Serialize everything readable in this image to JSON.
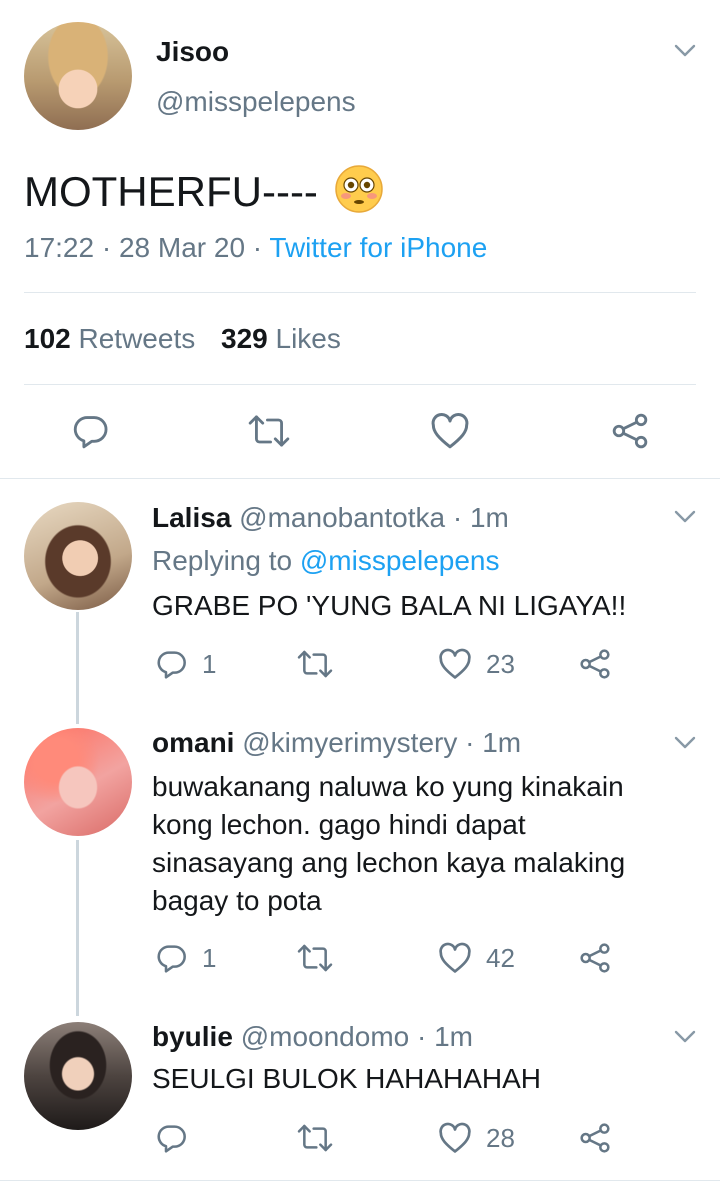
{
  "main_tweet": {
    "name": "Jisoo",
    "handle": "@misspelepens",
    "text": "MOTHERFU----",
    "emoji_icon": "flushed-face-emoji",
    "time": "17:22 · 28 Mar 20 ·",
    "source": "Twitter for iPhone",
    "retweets_count": "102",
    "retweets_label": "Retweets",
    "likes_count": "329",
    "likes_label": "Likes"
  },
  "replies": [
    {
      "name": "Lalisa",
      "handle": "@manobantotka · 1m",
      "replying_prefix": "Replying to",
      "replying_handle": "@misspelepens",
      "text": "GRABE PO 'YUNG BALA NI LIGAYA!!",
      "reply_count": "1",
      "retweet_count": "",
      "like_count": "23"
    },
    {
      "name": "omani",
      "handle": "@kimyerimystery · 1m",
      "text_lines": [
        "buwakanang naluwa ko yung kinakain",
        "kong lechon. gago hindi dapat",
        "sinasayang ang lechon kaya malaking",
        "bagay to pota"
      ],
      "reply_count": "1",
      "retweet_count": "",
      "like_count": "42"
    },
    {
      "name": "byulie",
      "handle": "@moondomo · 1m",
      "text": "SEULGI BULOK HAHAHAHAH",
      "reply_count": "",
      "retweet_count": "",
      "like_count": "28"
    }
  ],
  "colors": {
    "accent": "#1da1f2",
    "text": "#14171a",
    "secondary": "#657786",
    "divider": "#e1e8ed",
    "thread_line": "#ccd6dd"
  }
}
